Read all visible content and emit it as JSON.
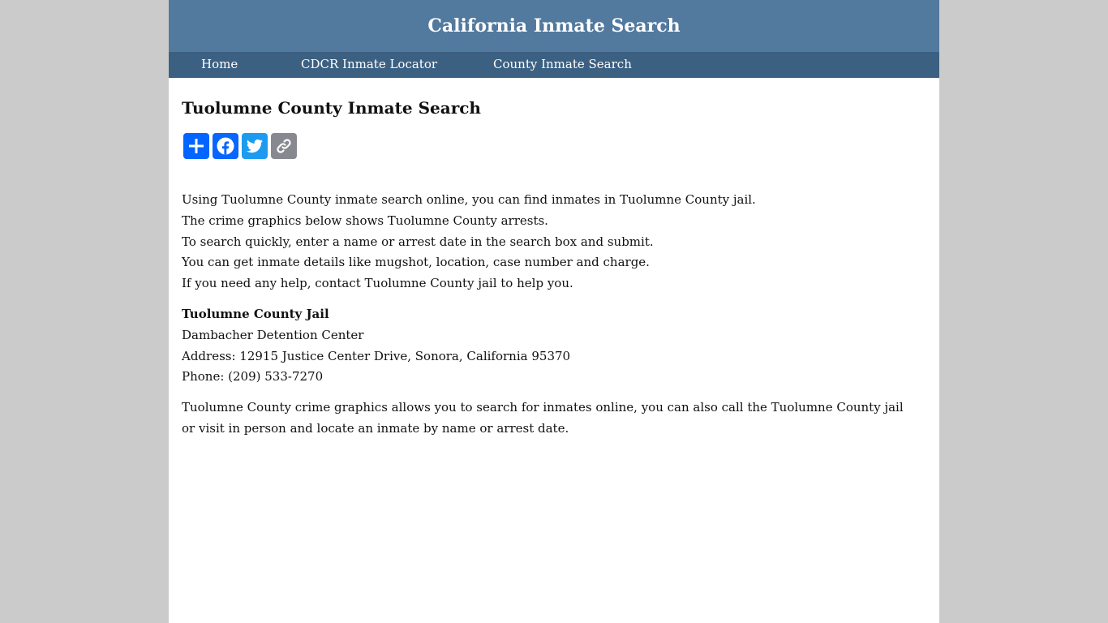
{
  "header": {
    "title": "California Inmate Search"
  },
  "nav": {
    "items": [
      {
        "label": "Home"
      },
      {
        "label": "CDCR Inmate Locator"
      },
      {
        "label": "County Inmate Search"
      }
    ]
  },
  "main": {
    "title": "Tuolumne County Inmate Search",
    "share": [
      {
        "name": "share",
        "icon": "plus-icon",
        "color": "#0166ff"
      },
      {
        "name": "facebook",
        "icon": "facebook-icon",
        "color": "#0866ff"
      },
      {
        "name": "twitter",
        "icon": "twitter-icon",
        "color": "#1d9bf0"
      },
      {
        "name": "copy-link",
        "icon": "link-icon",
        "color": "#888990"
      }
    ],
    "intro_lines": [
      "Using Tuolumne County inmate search online, you can find inmates in Tuolumne County jail.",
      "The crime graphics below shows Tuolumne County arrests.",
      "To search quickly, enter a name or arrest date in the search box and submit.",
      "You can get inmate details like mugshot, location, case number and charge.",
      "If you need any help, contact Tuolumne County jail to help you."
    ],
    "jail": {
      "name": "Tuolumne County Jail",
      "facility": "Dambacher Detention Center",
      "address": "Address: 12915 Justice Center Drive, Sonora, California 95370",
      "phone": "Phone: (209) 533-7270"
    },
    "closing": "Tuolumne County crime graphics allows you to search for inmates online, you can also call the Tuolumne County jail or visit in person and locate an inmate by name or arrest date."
  },
  "colors": {
    "header_bg": "#52799e",
    "nav_bg": "#3c6082",
    "page_bg": "#cbcbcb"
  }
}
